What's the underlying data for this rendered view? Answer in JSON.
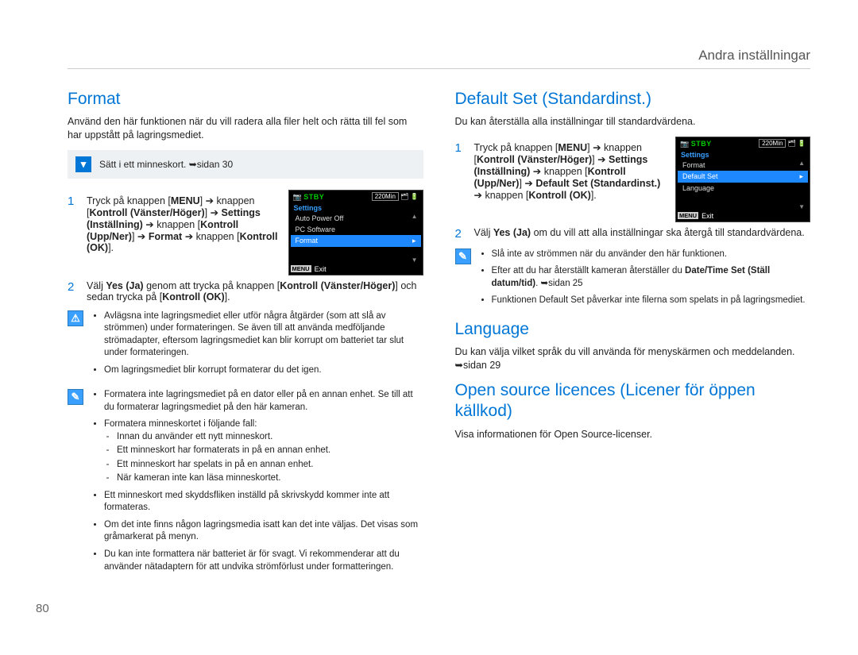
{
  "header": {
    "title": "Andra inställningar"
  },
  "page_number": "80",
  "left": {
    "h_format": "Format",
    "p_intro": "Använd den här funktionen när du vill radera alla filer helt och rätta till fel som har uppstått på lagringsmediet.",
    "infobox": "Sätt i ett minneskort. ➥sidan 30",
    "step1": {
      "pre": "Tryck på knappen [",
      "menu": "MENU",
      "post1": "] ➔ knappen [",
      "kontroll_vh": "Kontroll (Vänster/Höger)",
      "post2": "] ➔ ",
      "settings": "Settings (Inställning)",
      "post3": " ➔ knappen [",
      "kontroll_un": "Kontroll (Upp/Ner)",
      "post4": "] ➔ ",
      "format": "Format",
      "post5": " ➔ knappen [",
      "kontroll_ok": "Kontroll (OK)",
      "post6": "]."
    },
    "step2": {
      "pre": "Välj ",
      "yes": "Yes (Ja)",
      "post1": " genom att trycka på knappen [",
      "kontroll_vh": "Kontroll (Vänster/Höger)",
      "post2": "] och sedan trycka på [",
      "kontroll_ok": "Kontroll (OK)",
      "post3": "]."
    },
    "warn": {
      "b1": "Avlägsna inte lagringsmediet eller utför några åtgärder (som att slå av strömmen) under formateringen. Se även till att använda medföljande strömadapter, eftersom lagringsmediet kan blir korrupt om batteriet tar slut under formateringen.",
      "b2": "Om lagringsmediet blir korrupt formaterar du det igen."
    },
    "note": {
      "b1": "Formatera inte lagringsmediet på en dator eller på en annan enhet. Se till att du formaterar lagringsmediet på den här kameran.",
      "b2": "Formatera minneskortet i följande fall:",
      "s1": "Innan du använder ett nytt minneskort.",
      "s2": "Ett minneskort har formaterats in på en annan enhet.",
      "s3": "Ett minneskort har spelats in på en annan enhet.",
      "s4": "När kameran inte kan läsa minneskortet.",
      "b3": "Ett minneskort med skyddsfliken inställd på skrivskydd kommer inte att formateras.",
      "b4": "Om det inte finns någon lagringsmedia isatt kan det inte väljas. Det visas som gråmarkerat på menyn.",
      "b5": "Du kan inte formattera när batteriet är för svagt. Vi rekommenderar att du använder nätadaptern för att undvika strömförlust under formatteringen."
    },
    "cam": {
      "stby": "STBY",
      "time": "220Min",
      "settings": "Settings",
      "i1": "Auto Power Off",
      "i2": "PC Software",
      "i3": "Format",
      "exit_menu": "MENU",
      "exit": "Exit"
    }
  },
  "right": {
    "h_default": "Default Set (Standardinst.)",
    "p_default_intro": "Du kan återställa alla inställningar till standardvärdena.",
    "step1": {
      "pre": "Tryck på knappen [",
      "menu": "MENU",
      "post1": "] ➔ knappen [",
      "kontroll_vh": "Kontroll (Vänster/Höger)",
      "post2": "] ➔ ",
      "settings": "Settings (Inställning)",
      "post3": " ➔ knappen [",
      "kontroll_un": "Kontroll (Upp/Ner)",
      "post4": "] ➔ ",
      "default_set": "Default Set (Standardinst.)",
      "post5": " ➔ knappen [",
      "kontroll_ok": "Kontroll (OK)",
      "post6": "]."
    },
    "step2": {
      "pre": "Välj ",
      "yes": "Yes (Ja)",
      "post": " om du vill att alla inställningar ska återgå till standardvärdena."
    },
    "note": {
      "b1": "Slå inte av strömmen när du använder den här funktionen.",
      "b2a": "Efter att du har återställt kameran återställer du ",
      "b2b": "Date/Time Set (Ställ datum/tid)",
      "b2c": ". ➥sidan 25",
      "b3": "Funktionen Default Set påverkar inte filerna som spelats in på lagringsmediet."
    },
    "cam": {
      "stby": "STBY",
      "time": "220Min",
      "settings": "Settings",
      "i1": "Format",
      "i2": "Default Set",
      "i3": "Language",
      "exit_menu": "MENU",
      "exit": "Exit"
    },
    "h_language": "Language",
    "p_language": "Du kan välja vilket språk du vill använda för menyskärmen och meddelanden. ➥sidan 29",
    "h_open": "Open source licences (Licener för öppen källkod)",
    "p_open": "Visa informationen för Open Source-licenser."
  }
}
